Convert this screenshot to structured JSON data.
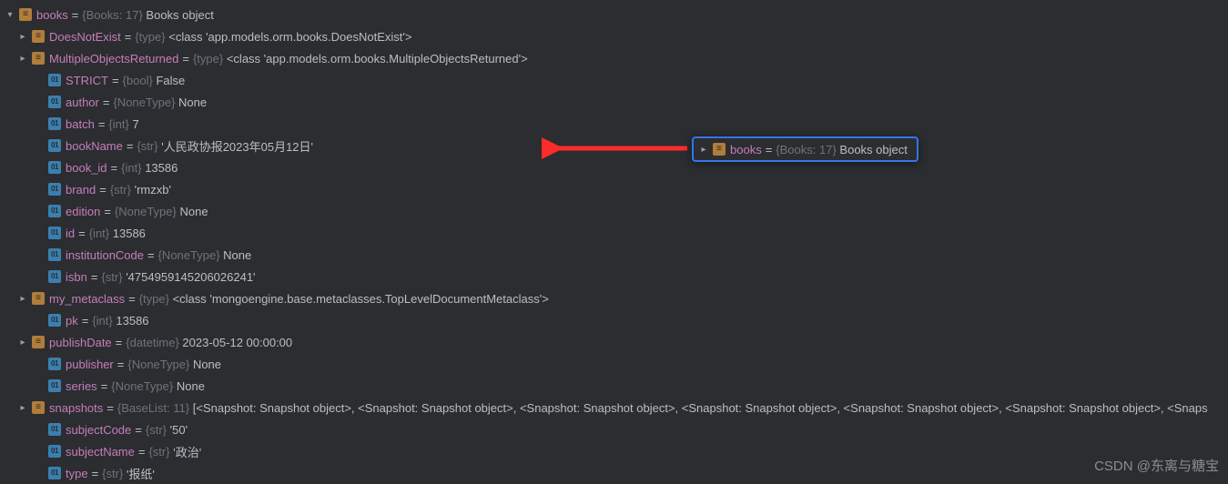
{
  "root": {
    "name": "books",
    "type": "{Books: 17}",
    "value": "Books object"
  },
  "rows": [
    {
      "kind": "obj",
      "caret": "right",
      "name": "DoesNotExist",
      "type": "{type}",
      "value": "<class 'app.models.orm.books.DoesNotExist'>"
    },
    {
      "kind": "obj",
      "caret": "right",
      "name": "MultipleObjectsReturned",
      "type": "{type}",
      "value": "<class 'app.models.orm.books.MultipleObjectsReturned'>"
    },
    {
      "kind": "field",
      "caret": "",
      "name": "STRICT",
      "type": "{bool}",
      "value": "False"
    },
    {
      "kind": "field",
      "caret": "",
      "name": "author",
      "type": "{NoneType}",
      "value": "None"
    },
    {
      "kind": "field",
      "caret": "",
      "name": "batch",
      "type": "{int}",
      "value": "7"
    },
    {
      "kind": "field",
      "caret": "",
      "name": "bookName",
      "type": "{str}",
      "value": "'人民政协报2023年05月12日'"
    },
    {
      "kind": "field",
      "caret": "",
      "name": "book_id",
      "type": "{int}",
      "value": "13586"
    },
    {
      "kind": "field",
      "caret": "",
      "name": "brand",
      "type": "{str}",
      "value": "'rmzxb'"
    },
    {
      "kind": "field",
      "caret": "",
      "name": "edition",
      "type": "{NoneType}",
      "value": "None"
    },
    {
      "kind": "field",
      "caret": "",
      "name": "id",
      "type": "{int}",
      "value": "13586"
    },
    {
      "kind": "field",
      "caret": "",
      "name": "institutionCode",
      "type": "{NoneType}",
      "value": "None"
    },
    {
      "kind": "field",
      "caret": "",
      "name": "isbn",
      "type": "{str}",
      "value": "'4754959145206026241'"
    },
    {
      "kind": "obj",
      "caret": "right",
      "name": "my_metaclass",
      "type": "{type}",
      "value": "<class 'mongoengine.base.metaclasses.TopLevelDocumentMetaclass'>"
    },
    {
      "kind": "field",
      "caret": "",
      "name": "pk",
      "type": "{int}",
      "value": "13586"
    },
    {
      "kind": "obj",
      "caret": "right",
      "name": "publishDate",
      "type": "{datetime}",
      "value": "2023-05-12 00:00:00"
    },
    {
      "kind": "field",
      "caret": "",
      "name": "publisher",
      "type": "{NoneType}",
      "value": "None"
    },
    {
      "kind": "field",
      "caret": "",
      "name": "series",
      "type": "{NoneType}",
      "value": "None"
    },
    {
      "kind": "obj",
      "caret": "right",
      "name": "snapshots",
      "type": "{BaseList: 11}",
      "value": "[<Snapshot: Snapshot object>, <Snapshot: Snapshot object>, <Snapshot: Snapshot object>, <Snapshot: Snapshot object>, <Snapshot: Snapshot object>, <Snapshot: Snapshot object>, <Snaps"
    },
    {
      "kind": "field",
      "caret": "",
      "name": "subjectCode",
      "type": "{str}",
      "value": "'50'"
    },
    {
      "kind": "field",
      "caret": "",
      "name": "subjectName",
      "type": "{str}",
      "value": "'政治'"
    },
    {
      "kind": "field",
      "caret": "",
      "name": "type",
      "type": "{str}",
      "value": "'报纸'"
    }
  ],
  "tooltip": {
    "name": "books",
    "type": "{Books: 17}",
    "value": "Books object"
  },
  "watermark": "CSDN @东离与糖宝"
}
